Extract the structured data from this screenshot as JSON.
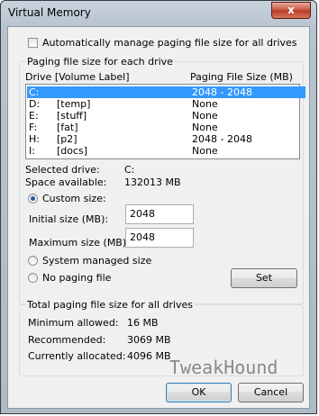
{
  "window": {
    "title": "Virtual Memory",
    "close_label": "x"
  },
  "auto_manage": {
    "label": "Automatically manage paging file size for all drives",
    "checked": false
  },
  "paging_group": {
    "label": "Paging file size for each drive",
    "headers": {
      "drive": "Drive  [Volume Label]",
      "size": "Paging File Size (MB)"
    },
    "rows": [
      {
        "drive": "C:",
        "label": "",
        "size": "2048 - 2048",
        "selected": true
      },
      {
        "drive": "D:",
        "label": "[temp]",
        "size": "None",
        "selected": false
      },
      {
        "drive": "E:",
        "label": "[stuff]",
        "size": "None",
        "selected": false
      },
      {
        "drive": "F:",
        "label": "[fat]",
        "size": "None",
        "selected": false
      },
      {
        "drive": "H:",
        "label": "[p2]",
        "size": "2048 - 2048",
        "selected": false
      },
      {
        "drive": "I:",
        "label": "[docs]",
        "size": "None",
        "selected": false
      }
    ],
    "selected_drive_label": "Selected drive:",
    "selected_drive_value": "C:",
    "space_available_label": "Space available:",
    "space_available_value": "132013 MB",
    "custom_size_label": "Custom size:",
    "initial_size_label": "Initial size (MB):",
    "initial_size_value": "2048",
    "maximum_size_label": "Maximum size (MB):",
    "maximum_size_value": "2048",
    "system_managed_label": "System managed size",
    "no_paging_label": "No paging file",
    "set_label": "Set"
  },
  "total_group": {
    "label": "Total paging file size for all drives",
    "minimum_label": "Minimum allowed:",
    "minimum_value": "16 MB",
    "recommended_label": "Recommended:",
    "recommended_value": "3069 MB",
    "allocated_label": "Currently allocated:",
    "allocated_value": "4096 MB"
  },
  "watermark": "TweakHound",
  "buttons": {
    "ok": "OK",
    "cancel": "Cancel"
  }
}
